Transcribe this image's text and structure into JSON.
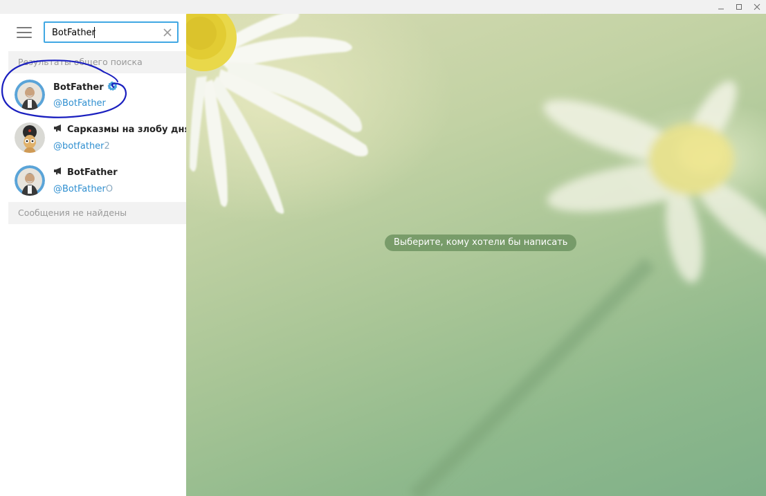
{
  "window": {
    "controls": [
      "minimize-icon",
      "maximize-icon",
      "close-icon"
    ]
  },
  "search": {
    "value": "BotFather",
    "clear_icon": "close-icon"
  },
  "sections": {
    "global_results": "Результаты общего поиска",
    "no_messages": "Сообщения не найдены"
  },
  "results": [
    {
      "title": "BotFather",
      "username": "@BotFather",
      "username_extra": "",
      "verified": true,
      "channel": false
    },
    {
      "title": "Сарказмы на злобу дня",
      "username": "@botfather",
      "username_extra": "2",
      "verified": false,
      "channel": true
    },
    {
      "title": "BotFather",
      "username": "@BotFather",
      "username_extra": "O",
      "verified": false,
      "channel": true
    }
  ],
  "chat": {
    "placeholder": "Выберите, кому хотели бы написать"
  },
  "colors": {
    "accent": "#40a7e3",
    "username": "#2f8fd0",
    "annotation": "#1a1fbf"
  }
}
